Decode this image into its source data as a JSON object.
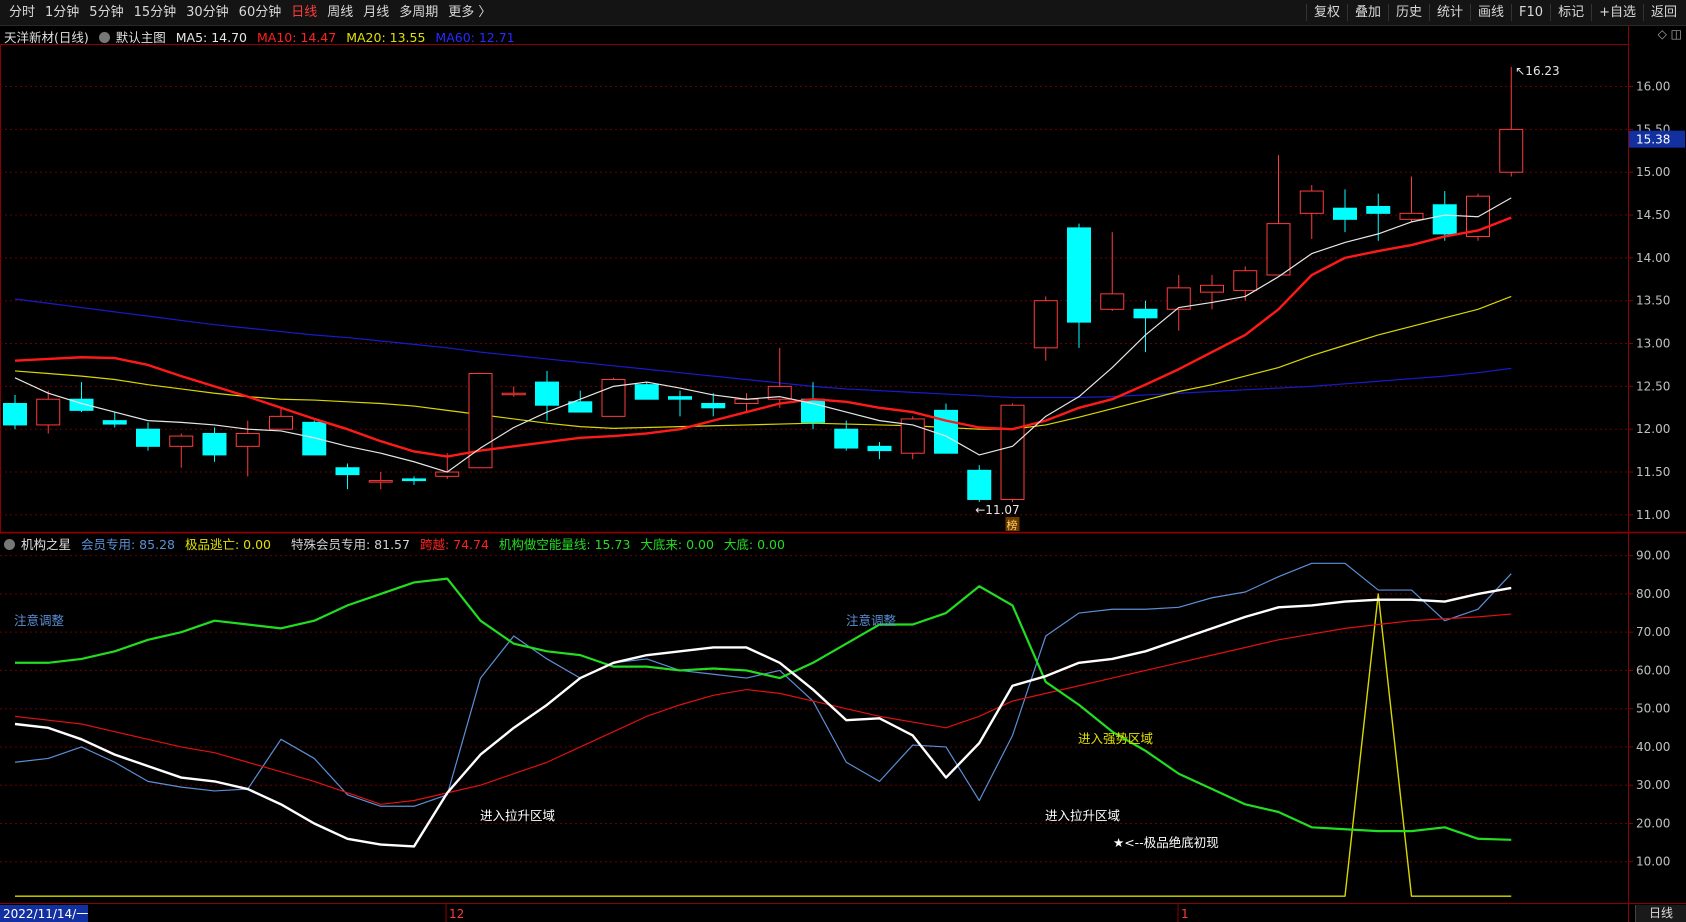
{
  "toolbar": {
    "left_items": [
      "分时",
      "1分钟",
      "5分钟",
      "15分钟",
      "30分钟",
      "60分钟",
      "日线",
      "周线",
      "月线",
      "多周期",
      "更多 〉"
    ],
    "active": "日线",
    "right_items": [
      "复权",
      "叠加",
      "历史",
      "统计",
      "画线",
      "F10",
      "标记",
      "+自选",
      "返回"
    ]
  },
  "main_header": {
    "title": "天洋新材(日线)",
    "template": "默认主图",
    "ma5": "MA5: 14.70",
    "ma10": "MA10: 14.47",
    "ma20": "MA20: 13.55",
    "ma60": "MA60: 12.71"
  },
  "indicator_header": {
    "name": "机构之星",
    "v1": "会员专用: 85.28",
    "v2": "极品逃亡: 0.00",
    "v3": "特殊会员专用: 81.57",
    "v4": "跨越: 74.74",
    "v5": "机构做空能量线: 15.73",
    "v6": "大底来: 0.00",
    "v7": "大底: 0.00"
  },
  "colors": {
    "up": "#ff3b3b",
    "down": "#00ffff",
    "ma5": "#e6e6e6",
    "ma10": "#ff1a1a",
    "ma20": "#d8d800",
    "ma60": "#1a1acc",
    "member": "#5b8fd6",
    "special": "#ffffff",
    "cross": "#e01010",
    "short_energy": "#22dd22",
    "escape": "#d8d800",
    "grid": "#6a0000",
    "frame": "#8b0000",
    "axis_text": "#c0c0c0",
    "price_tag_bg": "#1230a0"
  },
  "chart_data": [
    {
      "type": "candlestick",
      "title": "天洋新材(日线)",
      "y_ticks": [
        "16.00",
        "15.50",
        "15.00",
        "14.50",
        "14.00",
        "13.50",
        "13.00",
        "12.50",
        "12.00",
        "11.50",
        "11.00"
      ],
      "ylim": [
        10.8,
        16.45
      ],
      "current_price": "15.38",
      "high_label": "16.23",
      "low_label": "←11.07",
      "marker": "榜",
      "x_labels": [
        "2022/11/14/一",
        "12",
        "1"
      ],
      "ohlc": [
        [
          12.3,
          12.4,
          12.0,
          12.05
        ],
        [
          12.05,
          12.45,
          11.95,
          12.35
        ],
        [
          12.35,
          12.55,
          12.2,
          12.22
        ],
        [
          12.1,
          12.2,
          12.02,
          12.06
        ],
        [
          12.0,
          12.08,
          11.75,
          11.8
        ],
        [
          11.8,
          11.95,
          11.55,
          11.92
        ],
        [
          11.95,
          12.02,
          11.62,
          11.7
        ],
        [
          11.8,
          12.1,
          11.45,
          11.95
        ],
        [
          12.0,
          12.25,
          12.0,
          12.15
        ],
        [
          12.08,
          12.1,
          11.7,
          11.7
        ],
        [
          11.55,
          11.6,
          11.3,
          11.47
        ],
        [
          11.4,
          11.5,
          11.3,
          11.4
        ],
        [
          11.42,
          11.45,
          11.35,
          11.4
        ],
        [
          11.45,
          11.72,
          11.42,
          11.5
        ],
        [
          11.55,
          12.65,
          11.55,
          12.65
        ],
        [
          12.42,
          12.5,
          12.38,
          12.42
        ],
        [
          12.55,
          12.68,
          12.1,
          12.28
        ],
        [
          12.32,
          12.45,
          12.2,
          12.2
        ],
        [
          12.15,
          12.6,
          12.15,
          12.58
        ],
        [
          12.52,
          12.55,
          12.35,
          12.35
        ],
        [
          12.38,
          12.45,
          12.15,
          12.35
        ],
        [
          12.3,
          12.42,
          12.15,
          12.25
        ],
        [
          12.3,
          12.42,
          12.2,
          12.35
        ],
        [
          12.35,
          12.95,
          12.25,
          12.5
        ],
        [
          12.35,
          12.55,
          12.0,
          12.08
        ],
        [
          12.0,
          12.1,
          11.75,
          11.78
        ],
        [
          11.8,
          11.85,
          11.65,
          11.75
        ],
        [
          11.72,
          12.15,
          11.65,
          12.12
        ],
        [
          12.22,
          12.3,
          11.75,
          11.72
        ],
        [
          11.52,
          11.58,
          11.15,
          11.18
        ],
        [
          11.18,
          12.3,
          11.15,
          12.28
        ],
        [
          12.95,
          13.55,
          12.8,
          13.5
        ],
        [
          14.35,
          14.4,
          12.95,
          13.25
        ],
        [
          13.4,
          14.3,
          13.38,
          13.58
        ],
        [
          13.4,
          13.5,
          12.9,
          13.3
        ],
        [
          13.4,
          13.8,
          13.15,
          13.65
        ],
        [
          13.6,
          13.8,
          13.4,
          13.68
        ],
        [
          13.62,
          13.9,
          13.5,
          13.85
        ],
        [
          13.8,
          15.2,
          13.8,
          14.4
        ],
        [
          14.52,
          14.85,
          14.22,
          14.78
        ],
        [
          14.58,
          14.8,
          14.3,
          14.45
        ],
        [
          14.6,
          14.75,
          14.2,
          14.52
        ],
        [
          14.45,
          14.95,
          14.42,
          14.52
        ],
        [
          14.62,
          14.78,
          14.2,
          14.28
        ],
        [
          14.25,
          14.75,
          14.2,
          14.72
        ],
        [
          15.0,
          16.23,
          14.95,
          15.5
        ]
      ],
      "ma5": [
        12.6,
        12.42,
        12.3,
        12.2,
        12.1,
        12.08,
        12.05,
        12.0,
        11.98,
        11.9,
        11.8,
        11.72,
        11.62,
        11.5,
        11.78,
        12.02,
        12.2,
        12.35,
        12.5,
        12.55,
        12.48,
        12.4,
        12.35,
        12.38,
        12.3,
        12.2,
        12.1,
        12.05,
        11.92,
        11.7,
        11.8,
        12.15,
        12.38,
        12.72,
        13.1,
        13.42,
        13.48,
        13.55,
        13.78,
        14.05,
        14.18,
        14.28,
        14.42,
        14.5,
        14.48,
        14.7
      ],
      "ma10": [
        12.8,
        12.82,
        12.84,
        12.83,
        12.75,
        12.62,
        12.5,
        12.38,
        12.25,
        12.12,
        12.0,
        11.86,
        11.74,
        11.68,
        11.75,
        11.8,
        11.85,
        11.9,
        11.92,
        11.95,
        12.0,
        12.1,
        12.2,
        12.3,
        12.35,
        12.32,
        12.25,
        12.2,
        12.1,
        12.02,
        12.0,
        12.1,
        12.25,
        12.35,
        12.52,
        12.7,
        12.9,
        13.1,
        13.4,
        13.8,
        14.0,
        14.08,
        14.15,
        14.25,
        14.32,
        14.47
      ],
      "ma20": [
        12.68,
        12.65,
        12.62,
        12.58,
        12.52,
        12.47,
        12.42,
        12.38,
        12.35,
        12.34,
        12.32,
        12.3,
        12.27,
        12.22,
        12.17,
        12.12,
        12.07,
        12.03,
        12.01,
        12.02,
        12.03,
        12.04,
        12.05,
        12.06,
        12.07,
        12.06,
        12.05,
        12.04,
        12.02,
        12.0,
        12.0,
        12.05,
        12.14,
        12.24,
        12.34,
        12.44,
        12.52,
        12.62,
        12.72,
        12.86,
        12.98,
        13.1,
        13.2,
        13.3,
        13.4,
        13.55
      ],
      "ma60": [
        13.52,
        13.47,
        13.42,
        13.37,
        13.32,
        13.27,
        13.22,
        13.18,
        13.14,
        13.1,
        13.07,
        13.03,
        12.99,
        12.95,
        12.9,
        12.86,
        12.82,
        12.78,
        12.74,
        12.7,
        12.66,
        12.62,
        12.58,
        12.54,
        12.5,
        12.47,
        12.45,
        12.43,
        12.41,
        12.39,
        12.37,
        12.37,
        12.37,
        12.38,
        12.4,
        12.42,
        12.44,
        12.46,
        12.48,
        12.5,
        12.53,
        12.56,
        12.59,
        12.62,
        12.66,
        12.71
      ]
    },
    {
      "type": "line",
      "title": "机构之星",
      "y_ticks": [
        "90.00",
        "80.00",
        "70.00",
        "60.00",
        "50.00",
        "40.00",
        "30.00",
        "20.00",
        "10.00"
      ],
      "ylim": [
        0,
        92
      ],
      "annotations": [
        "注意调整",
        "注意调整",
        "进入强势区域",
        "进入拉升区域",
        "进入拉升区域",
        "★<--极品绝底初现"
      ],
      "series": [
        {
          "name": "会员专用",
          "values": [
            36,
            37,
            40,
            36,
            31,
            29.5,
            28.5,
            29,
            42,
            37,
            27.5,
            24.5,
            24.5,
            27.5,
            58,
            69,
            63,
            58,
            62,
            63,
            60,
            59,
            58,
            60,
            52,
            36,
            31,
            40.5,
            40,
            26,
            43,
            69,
            75,
            76,
            76,
            76.5,
            79,
            80.5,
            84.5,
            88,
            88,
            81,
            81,
            73,
            76,
            85.28
          ]
        },
        {
          "name": "极品逃亡",
          "values": [
            1,
            1,
            1,
            1,
            1,
            1,
            1,
            1,
            1,
            1,
            1,
            1,
            1,
            1,
            1,
            1,
            1,
            1,
            1,
            1,
            1,
            1,
            1,
            1,
            1,
            1,
            1,
            1,
            1,
            1,
            1,
            1,
            1,
            1,
            1,
            1,
            1,
            1,
            1,
            1,
            1,
            80,
            1,
            1,
            1,
            1
          ]
        },
        {
          "name": "特殊会员专用",
          "values": [
            46,
            45,
            42,
            38,
            35,
            32,
            31,
            29,
            25,
            20,
            16,
            14.5,
            14,
            28,
            38,
            45,
            51,
            58,
            62,
            64,
            65,
            66,
            66,
            62,
            55,
            47,
            47.5,
            43,
            32,
            41,
            56,
            58.5,
            62,
            63,
            65,
            68,
            71,
            74,
            76.5,
            77,
            78,
            78.5,
            78.5,
            78,
            80,
            81.57
          ]
        },
        {
          "name": "跨越",
          "values": [
            48,
            47,
            46,
            44,
            42,
            40,
            38.5,
            36,
            33.5,
            31,
            28,
            25,
            26,
            28,
            30,
            33,
            36,
            40,
            44,
            48,
            51,
            53.5,
            55,
            54,
            52,
            50,
            48,
            46.5,
            45,
            48,
            52,
            54,
            56,
            58,
            60,
            62,
            64,
            66,
            68,
            69.5,
            71,
            72,
            73,
            73.5,
            74,
            74.74
          ]
        },
        {
          "name": "机构做空能量线",
          "values": [
            62,
            62,
            63,
            65,
            68,
            70,
            73,
            72,
            71,
            73,
            77,
            80,
            83,
            84,
            73,
            67,
            65,
            64,
            61,
            61,
            60,
            60.5,
            60,
            58,
            62,
            67,
            72,
            72,
            75,
            82,
            77,
            57,
            51,
            44,
            39,
            33,
            29,
            25,
            23,
            19,
            18.5,
            18,
            18,
            19,
            16,
            15.73
          ]
        }
      ]
    }
  ]
}
